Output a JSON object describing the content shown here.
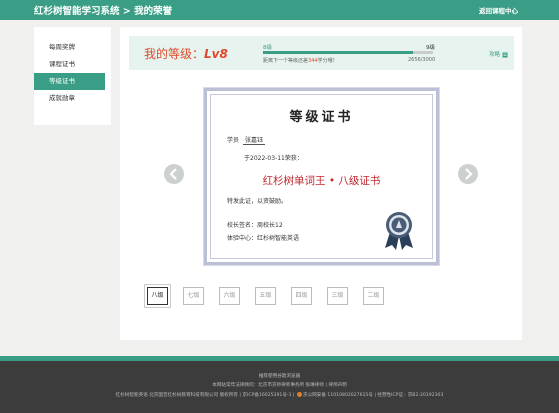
{
  "header": {
    "title": "红杉树智能学习系统 > 我的荣誉",
    "back_label": "返回课程中心"
  },
  "sidebar": {
    "items": [
      {
        "label": "每周奖牌",
        "active": false
      },
      {
        "label": "课程证书",
        "active": false
      },
      {
        "label": "等级证书",
        "active": true
      },
      {
        "label": "成就勋章",
        "active": false
      }
    ]
  },
  "level": {
    "label_prefix": "我的等级：",
    "label_value": "Lv8",
    "start_label": "8级",
    "end_label": "9级",
    "progress_fraction": 0.885,
    "hint_prefix": "距离下一个等级还差",
    "hint_value": "344",
    "hint_suffix": "学分哦！",
    "progress_text": "2656/3000",
    "link_label": "攻略",
    "accent": "#3a9e86"
  },
  "certificate": {
    "title": "等级证书",
    "student_label": "学员",
    "student_name": "张嘉钰",
    "date_line": "于2022-03-11荣获：",
    "award": "红杉树单词王 • 八级证书",
    "note": "特发此证，以资鼓励。",
    "sign": "校长签名：周校长12",
    "center": "体验中心：红杉树智能英语",
    "award_color": "#c0262d"
  },
  "levels": [
    {
      "label": "八级",
      "active": true
    },
    {
      "label": "七级",
      "active": false
    },
    {
      "label": "六级",
      "active": false
    },
    {
      "label": "五级",
      "active": false
    },
    {
      "label": "四级",
      "active": false
    },
    {
      "label": "三级",
      "active": false
    },
    {
      "label": "二级",
      "active": false
    }
  ],
  "navigation": {
    "prev_icon": "chevron-left-icon",
    "next_icon": "chevron-right-icon"
  },
  "footer": {
    "line1": "推荐使用谷歌浏览器",
    "line2": "本网站常年法律顾问：北京市京师律师事务所 张琳律师 | 律师声明",
    "line3a": "红杉树智能英语 北京国音红杉树教育科技有限公司 版权所有 | 京ICP备16025391号-1 |",
    "line3b": "京公网安备 11010802027615号 | 经营性ICP证：京B2-20192303"
  }
}
